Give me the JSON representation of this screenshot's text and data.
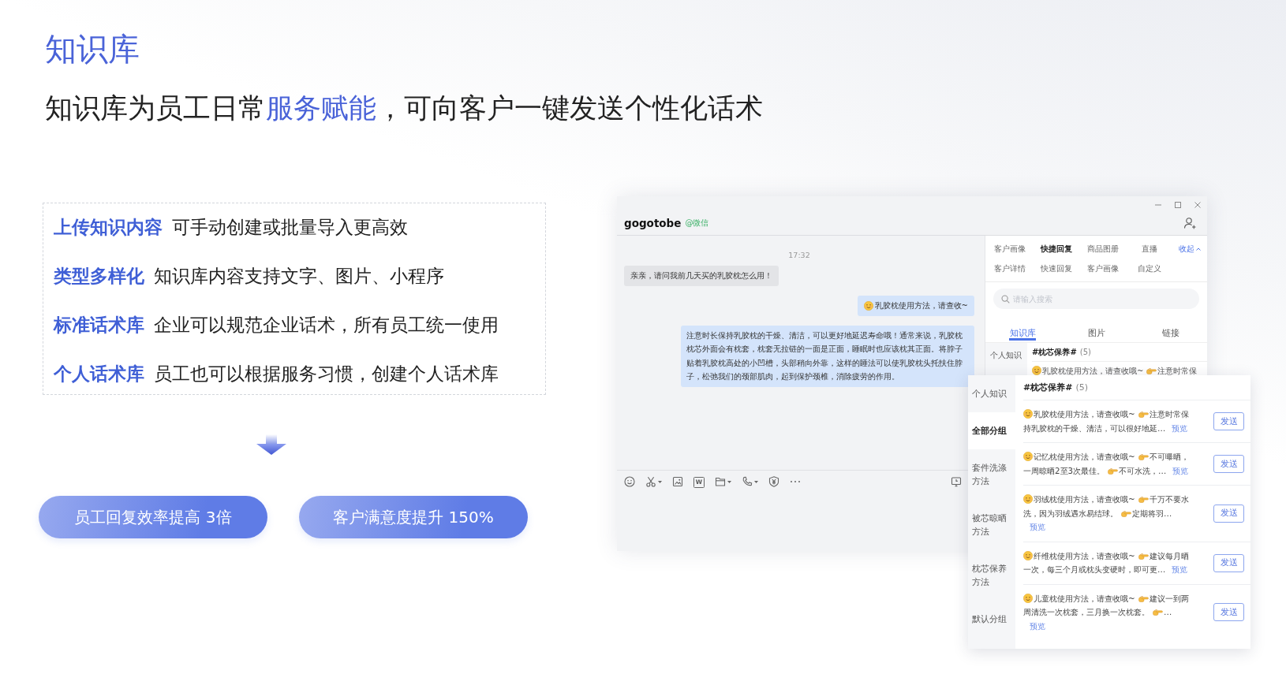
{
  "title": "知识库",
  "subtitle": [
    {
      "text": "知识库为员工日常",
      "highlight": false
    },
    {
      "text": "服务赋能",
      "highlight": true
    },
    {
      "text": "，可向客户一键发送个性化话术",
      "highlight": false
    }
  ],
  "features": [
    {
      "label": "上传知识内容",
      "text": "可手动创建或批量导入更高效"
    },
    {
      "label": "类型多样化",
      "text": "知识库内容支持文字、图片、小程序"
    },
    {
      "label": "标准话术库",
      "text": "企业可以规范企业话术，所有员工统一使用"
    },
    {
      "label": "个人话术库",
      "text": "员工也可以根据服务习惯，创建个人话术库"
    }
  ],
  "stats": [
    "员工回复效率提高 3倍",
    "客户满意度提升 150%"
  ],
  "chat_window": {
    "contact": {
      "name": "gogotobe",
      "channel": "@微信"
    },
    "time": "17:32",
    "messages": [
      {
        "kind": "received",
        "text": "亲亲，请问我前几天买的乳胶枕怎么用！"
      },
      {
        "kind": "sent_emoji",
        "text": "乳胶枕使用方法，请查收~"
      },
      {
        "kind": "sent",
        "text": "注意时长保持乳胶枕的干燥、清洁，可以更好地延迟寿命哦！通常来说，乳胶枕枕芯外面会有枕套，枕套无拉链的一面是正面，睡眠时也应该枕其正面。将脖子贴着乳胶枕高处的小凹槽，头部稍向外靠，这样的睡法可以使乳胶枕头托扶住脖子，松弛我们的颈部肌肉，起到保护颈椎，消除疲劳的作用。"
      }
    ],
    "toolbar": {
      "doc_glyph": "W"
    },
    "side_panel": {
      "tabs": [
        {
          "label": "客户画像",
          "selected": false
        },
        {
          "label": "快捷回复",
          "selected": true
        },
        {
          "label": "商品图册",
          "selected": false
        },
        {
          "label": "直播",
          "selected": false
        },
        {
          "label": "客户详情",
          "selected": false
        },
        {
          "label": "快速回复",
          "selected": false
        },
        {
          "label": "客户画像",
          "selected": false
        },
        {
          "label": "自定义",
          "selected": false
        }
      ],
      "collapse": "收起",
      "search": {
        "placeholder": "请输入搜索"
      },
      "subtabs": [
        {
          "label": "知识库",
          "selected": true
        },
        {
          "label": "图片",
          "selected": false
        },
        {
          "label": "链接",
          "selected": false
        }
      ],
      "groups": [
        {
          "label": "个人知识",
          "selected": false
        }
      ],
      "list_title": "#枕芯保养#",
      "list_count": "(5)",
      "first_entry": [
        "乳胶枕使用方法，请查收哦~",
        "注意时常保"
      ]
    }
  },
  "knowledge_popup": {
    "groups": [
      {
        "label": "个人知识",
        "selected": false
      },
      {
        "label": "全部分组",
        "selected": true
      },
      {
        "label": "套件洗涤方法",
        "selected": false
      },
      {
        "label": "被芯晾晒方法",
        "selected": false
      },
      {
        "label": "枕芯保养方法",
        "selected": false
      },
      {
        "label": "默认分组",
        "selected": false
      }
    ],
    "list_title": "#枕芯保养#",
    "list_count": "(5)",
    "entries": [
      {
        "parts": [
          "乳胶枕使用方法，请查收哦~",
          "注意时常保持乳胶枕的干燥、清洁，可以很好地延…"
        ],
        "preview": "预览",
        "send": "发送"
      },
      {
        "parts": [
          "记忆枕使用方法，请查收哦~",
          "不可曝晒，一周晾晒2至3次最佳。",
          "不可水洗，…"
        ],
        "preview": "预览",
        "send": "发送"
      },
      {
        "parts": [
          "羽绒枕使用方法，请查收哦~",
          "千万不要水洗，因为羽绒遇水易结球。",
          "定期将羽…"
        ],
        "preview": "预览",
        "send": "发送"
      },
      {
        "parts": [
          "纤维枕使用方法，请查收哦~",
          "建议每月晒一次，每三个月或枕头变硬时，即可更…"
        ],
        "preview": "预览",
        "send": "发送"
      },
      {
        "parts": [
          "儿童枕使用方法，请查收哦~",
          "建议一到两周清洗一次枕套，三月换一次枕套。",
          "…"
        ],
        "preview": "预览",
        "send": "发送"
      }
    ]
  }
}
